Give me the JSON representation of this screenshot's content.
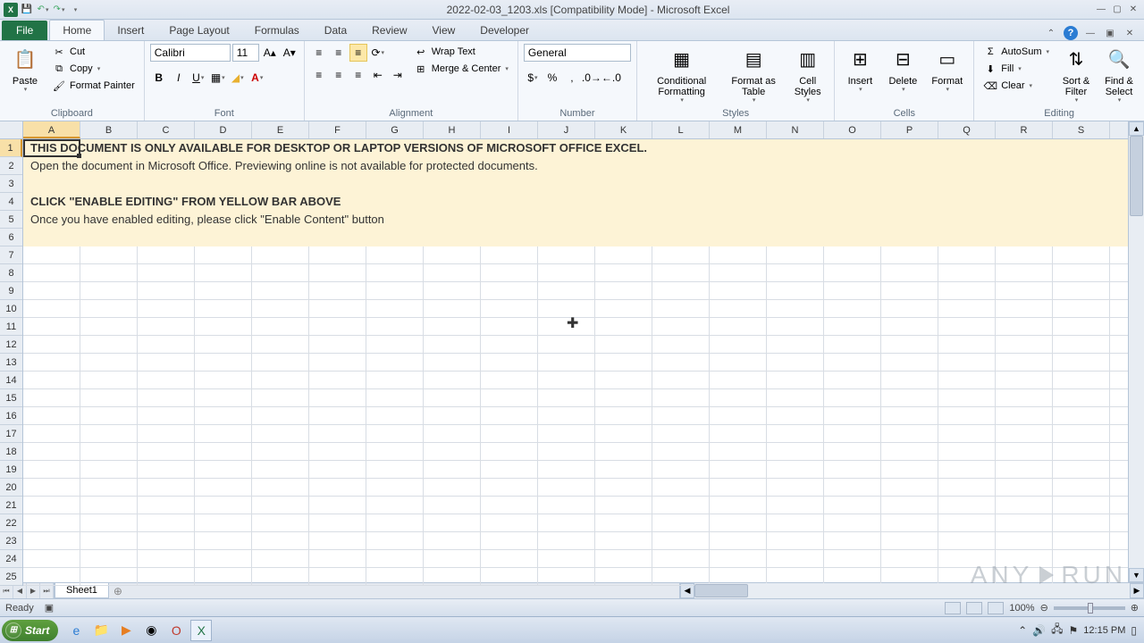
{
  "title": "2022-02-03_1203.xls  [Compatibility Mode]  -  Microsoft Excel",
  "tabs": {
    "file": "File",
    "home": "Home",
    "insert": "Insert",
    "pageLayout": "Page Layout",
    "formulas": "Formulas",
    "data": "Data",
    "review": "Review",
    "view": "View",
    "developer": "Developer"
  },
  "clipboard": {
    "paste": "Paste",
    "cut": "Cut",
    "copy": "Copy",
    "formatPainter": "Format Painter",
    "group": "Clipboard"
  },
  "font": {
    "name": "Calibri",
    "size": "11",
    "group": "Font"
  },
  "alignment": {
    "wrap": "Wrap Text",
    "merge": "Merge & Center",
    "group": "Alignment"
  },
  "number": {
    "format": "General",
    "group": "Number"
  },
  "styles": {
    "cond": "Conditional Formatting",
    "table": "Format as Table",
    "cell": "Cell Styles",
    "group": "Styles"
  },
  "cells": {
    "insert": "Insert",
    "delete": "Delete",
    "format": "Format",
    "group": "Cells"
  },
  "editing": {
    "autosum": "AutoSum",
    "fill": "Fill",
    "clear": "Clear",
    "sort": "Sort & Filter",
    "find": "Find & Select",
    "group": "Editing"
  },
  "columns": [
    "A",
    "B",
    "C",
    "D",
    "E",
    "F",
    "G",
    "H",
    "I",
    "J",
    "K",
    "L",
    "M",
    "N",
    "O",
    "P",
    "Q",
    "R",
    "S"
  ],
  "rows": [
    "1",
    "2",
    "3",
    "4",
    "5",
    "6",
    "7",
    "8",
    "9",
    "10",
    "11",
    "12",
    "13",
    "14",
    "15",
    "16",
    "17",
    "18",
    "19",
    "20",
    "21",
    "22",
    "23",
    "24",
    "25"
  ],
  "content": {
    "line1": "THIS DOCUMENT IS ONLY AVAILABLE FOR DESKTOP OR LAPTOP VERSIONS OF MICROSOFT OFFICE EXCEL.",
    "line2": "Open the document in Microsoft Office. Previewing online is not available for protected documents.",
    "line3": "CLICK \"ENABLE EDITING\" FROM YELLOW BAR ABOVE",
    "line4": "Once you have enabled editing, please click \"Enable Content\" button"
  },
  "sheetTab": "Sheet1",
  "status": "Ready",
  "zoom": "100%",
  "taskbar": {
    "start": "Start",
    "time": "12:15 PM"
  },
  "watermark": {
    "a": "ANY",
    "b": "RUN"
  }
}
